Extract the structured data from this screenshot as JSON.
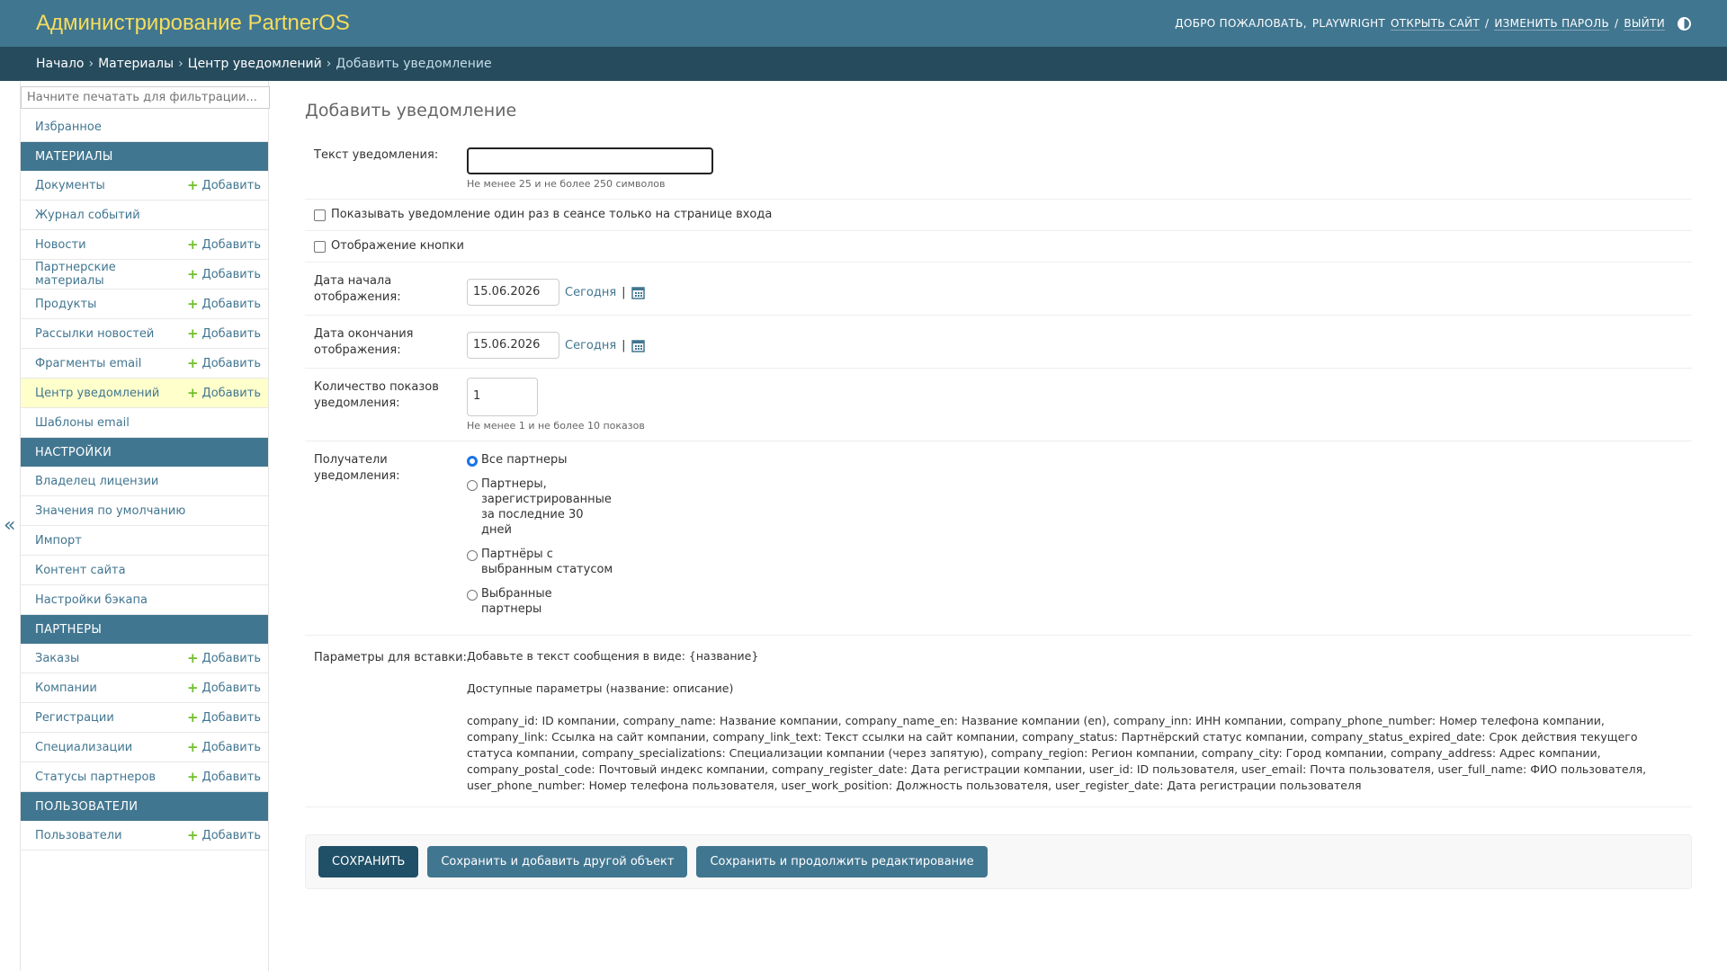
{
  "header": {
    "branding": "Администрирование PartnerOS",
    "welcome": "Добро пожаловать,",
    "username": "playwright",
    "view_site": "Открыть сайт",
    "change_password": "Изменить пароль",
    "logout": "Выйти",
    "separator": "/"
  },
  "breadcrumbs": {
    "home": "Начало",
    "app": "Материалы",
    "model": "Центр уведомлений",
    "current": "Добавить уведомление",
    "arrow": "›"
  },
  "sidebar": {
    "filter_placeholder": "Начните печатать для фильтрации...",
    "favorites": "Избранное",
    "add_label": "Добавить",
    "collapse_symbol": "«",
    "modules": [
      {
        "caption": "Материалы",
        "items": [
          {
            "label": "Документы",
            "add": true,
            "current": false
          },
          {
            "label": "Журнал событий",
            "add": false,
            "current": false
          },
          {
            "label": "Новости",
            "add": true,
            "current": false
          },
          {
            "label": "Партнерские материалы",
            "add": true,
            "current": false
          },
          {
            "label": "Продукты",
            "add": true,
            "current": false
          },
          {
            "label": "Рассылки новостей",
            "add": true,
            "current": false
          },
          {
            "label": "Фрагменты email",
            "add": true,
            "current": false
          },
          {
            "label": "Центр уведомлений",
            "add": true,
            "current": true
          },
          {
            "label": "Шаблоны email",
            "add": false,
            "current": false
          }
        ]
      },
      {
        "caption": "Настройки",
        "items": [
          {
            "label": "Владелец лицензии",
            "add": false,
            "current": false
          },
          {
            "label": "Значения по умолчанию",
            "add": false,
            "current": false
          },
          {
            "label": "Импорт",
            "add": false,
            "current": false
          },
          {
            "label": "Контент сайта",
            "add": false,
            "current": false
          },
          {
            "label": "Настройки бэкапа",
            "add": false,
            "current": false
          }
        ]
      },
      {
        "caption": "Партнеры",
        "items": [
          {
            "label": "Заказы",
            "add": true,
            "current": false
          },
          {
            "label": "Компании",
            "add": true,
            "current": false
          },
          {
            "label": "Регистрации",
            "add": true,
            "current": false
          },
          {
            "label": "Специализации",
            "add": true,
            "current": false
          },
          {
            "label": "Статусы партнеров",
            "add": true,
            "current": false
          }
        ]
      },
      {
        "caption": "Пользователи",
        "items": [
          {
            "label": "Пользователи",
            "add": true,
            "current": false
          }
        ]
      }
    ]
  },
  "form": {
    "title": "Добавить уведомление",
    "text": {
      "label": "Текст уведомления:",
      "value": "",
      "help": "Не менее 25 и не более 250 символов"
    },
    "show_once": {
      "label": "Показывать уведомление один раз в сеансе только на странице входа",
      "checked": false
    },
    "show_button": {
      "label": "Отображение кнопки",
      "checked": false
    },
    "start_date": {
      "label": "Дата начала отображения:",
      "value": "15.06.2026",
      "today": "Сегодня",
      "pipe": "|"
    },
    "end_date": {
      "label": "Дата окончания отображения:",
      "value": "15.06.2026",
      "today": "Сегодня",
      "pipe": "|"
    },
    "show_count": {
      "label": "Количество показов уведомления:",
      "value": "1",
      "help": "Не менее 1 и не более 10 показов"
    },
    "recipients": {
      "label": "Получатели уведомления:",
      "options": [
        {
          "label": "Все партнеры",
          "selected": true
        },
        {
          "label": "Партнеры, зарегистрированные за последние 30 дней",
          "selected": false
        },
        {
          "label": "Партнёры с выбранным статусом",
          "selected": false
        },
        {
          "label": "Выбранные партнеры",
          "selected": false
        }
      ]
    },
    "params": {
      "label": "Параметры для вставки:",
      "intro": "Добавьте в текст сообщения в виде: {название}",
      "available": "Доступные параметры (название: описание)",
      "list": "company_id: ID компании, company_name: Название компании, company_name_en: Название компании (en), company_inn: ИНН компании, company_phone_number: Номер телефона компании, company_link: Ссылка на сайт компании, company_link_text: Текст ссылки на сайт компании, company_status: Партнёрский статус компании, company_status_expired_date: Срок действия текущего статуса компании, company_specializations: Специализации компании (через запятую), company_region: Регион компании, company_city: Город компании, company_address: Адрес компании, company_postal_code: Почтовый индекс компании, company_register_date: Дата регистрации компании, user_id: ID пользователя, user_email: Почта пользователя, user_full_name: ФИО пользователя, user_phone_number: Номер телефона пользователя, user_work_position: Должность пользователя, user_register_date: Дата регистрации пользователя"
    }
  },
  "submit": {
    "save": "Сохранить",
    "save_add_another": "Сохранить и добавить другой объект",
    "save_continue": "Сохранить и продолжить редактирование"
  },
  "icons": {
    "calendar": "calendar-icon",
    "plus": "plus-icon",
    "theme": "theme-toggle-icon"
  },
  "colors": {
    "header_bg": "#417690",
    "branding": "#f5dd5d",
    "breadcrumbs_bg": "#264b5d",
    "add_plus": "#70bf2b",
    "current_row": "#ffffcc",
    "default_button": "#205067"
  }
}
